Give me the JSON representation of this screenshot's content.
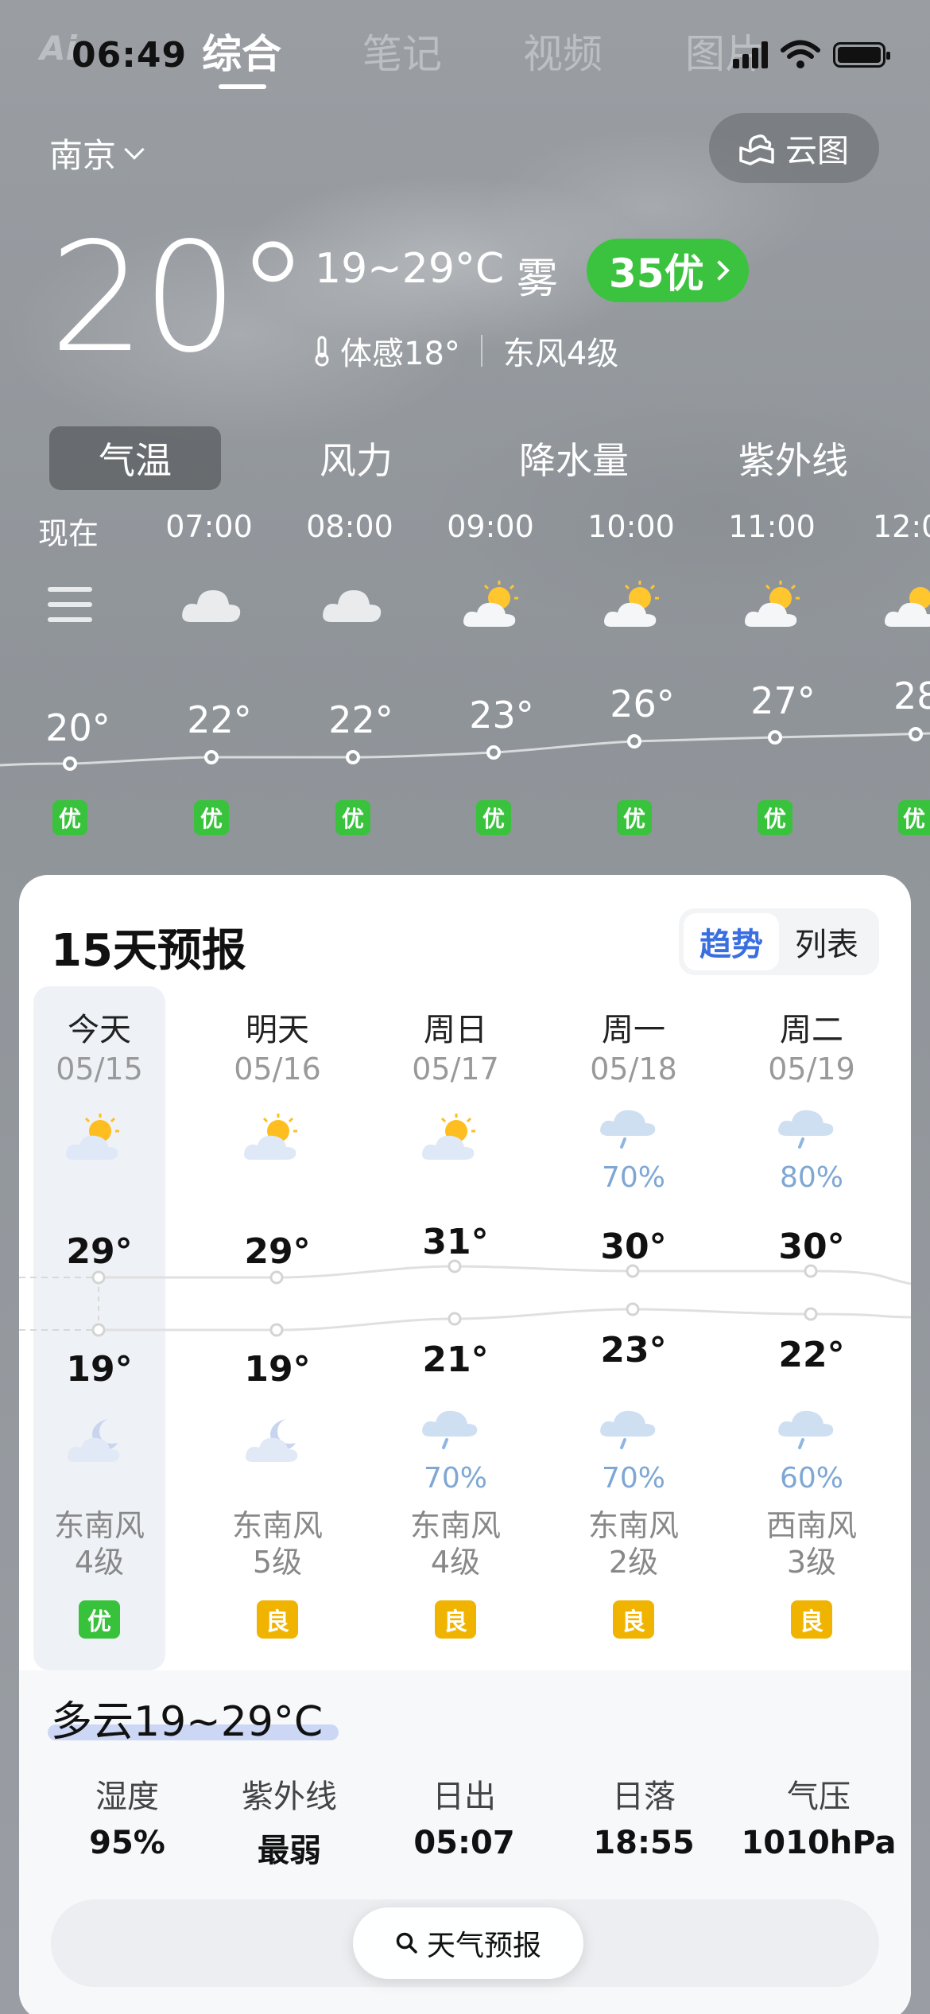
{
  "status": {
    "time": "06:49",
    "logo": "Ai"
  },
  "top_tabs": [
    "综合",
    "笔记",
    "视频",
    "图片"
  ],
  "location": {
    "city": "南京",
    "cloud_map_label": "云图"
  },
  "current": {
    "temp": "20°",
    "range": "19~29°C",
    "condition": "雾",
    "aqi_label": "35优",
    "feels_like": "体感18°",
    "wind": "东风4级"
  },
  "metric_tabs": [
    "气温",
    "风力",
    "降水量",
    "紫外线"
  ],
  "hourly": [
    {
      "time": "现在",
      "temp": "20°",
      "aqi": "优",
      "icon": "now-lines-icon"
    },
    {
      "time": "07:00",
      "temp": "22°",
      "aqi": "优",
      "icon": "cloud-icon"
    },
    {
      "time": "08:00",
      "temp": "22°",
      "aqi": "优",
      "icon": "cloud-icon"
    },
    {
      "time": "09:00",
      "temp": "23°",
      "aqi": "优",
      "icon": "partly-sunny-icon"
    },
    {
      "time": "10:00",
      "temp": "26°",
      "aqi": "优",
      "icon": "partly-sunny-icon"
    },
    {
      "time": "11:00",
      "temp": "27°",
      "aqi": "优",
      "icon": "partly-sunny-icon"
    },
    {
      "time": "12:0",
      "temp": "28",
      "aqi": "优",
      "icon": "partly-sunny-icon"
    }
  ],
  "forecast": {
    "title": "15天预报",
    "view_trend": "趋势",
    "view_list": "列表",
    "days": [
      {
        "day": "今天",
        "date": "05/15",
        "day_icon": "partly-sunny-icon",
        "day_pct": "",
        "high": "29°",
        "low": "19°",
        "night_icon": "moon-cloud-icon",
        "night_pct": "",
        "wind1": "东南风",
        "wind2": "4级",
        "aq": "优",
        "aq_color": "#38c23b"
      },
      {
        "day": "明天",
        "date": "05/16",
        "day_icon": "partly-sunny-icon",
        "day_pct": "",
        "high": "29°",
        "low": "19°",
        "night_icon": "moon-cloud-icon",
        "night_pct": "",
        "wind1": "东南风",
        "wind2": "5级",
        "aq": "良",
        "aq_color": "#f0b400"
      },
      {
        "day": "周日",
        "date": "05/17",
        "day_icon": "partly-sunny-icon",
        "day_pct": "",
        "high": "31°",
        "low": "21°",
        "night_icon": "rain-cloud-icon",
        "night_pct": "70%",
        "wind1": "东南风",
        "wind2": "4级",
        "aq": "良",
        "aq_color": "#f0b400"
      },
      {
        "day": "周一",
        "date": "05/18",
        "day_icon": "rain-cloud-icon",
        "day_pct": "70%",
        "high": "30°",
        "low": "23°",
        "night_icon": "rain-cloud-icon",
        "night_pct": "70%",
        "wind1": "东南风",
        "wind2": "2级",
        "aq": "良",
        "aq_color": "#f0b400"
      },
      {
        "day": "周二",
        "date": "05/19",
        "day_icon": "rain-cloud-icon",
        "day_pct": "80%",
        "high": "30°",
        "low": "22°",
        "night_icon": "rain-cloud-icon",
        "night_pct": "60%",
        "wind1": "西南风",
        "wind2": "3级",
        "aq": "良",
        "aq_color": "#f0b400"
      }
    ]
  },
  "today_detail": {
    "summary": "多云19~29°C",
    "stats": [
      {
        "label": "湿度",
        "value": "95%"
      },
      {
        "label": "紫外线",
        "value": "最弱"
      },
      {
        "label": "日出",
        "value": "05:07"
      },
      {
        "label": "日落",
        "value": "18:55"
      },
      {
        "label": "气压",
        "value": "1010hPa"
      }
    ]
  },
  "search": {
    "label": "天气预报"
  }
}
